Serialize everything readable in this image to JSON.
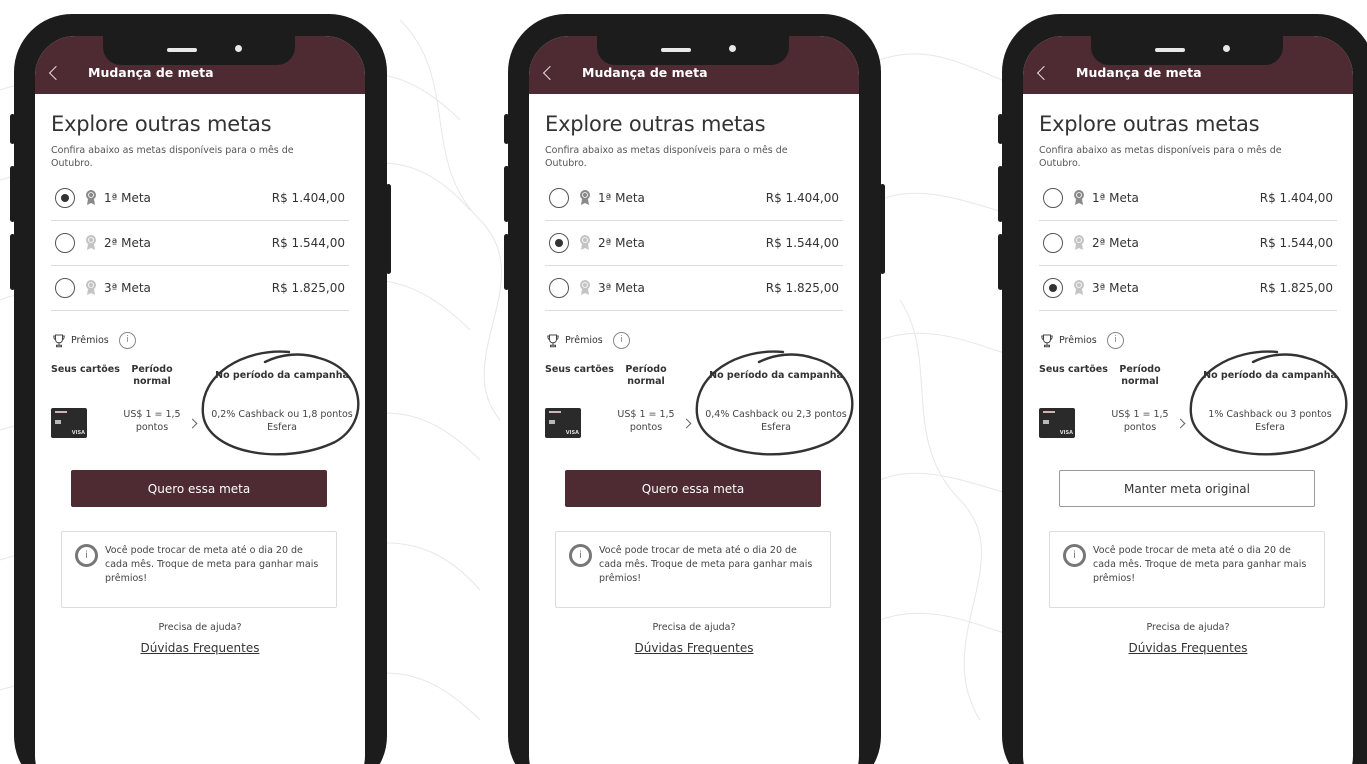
{
  "colors": {
    "brand": "#4e2a32",
    "frame": "#1c1c1c",
    "text": "#333333"
  },
  "icons": [
    "back-chevron-icon",
    "medal-icon",
    "trophy-icon",
    "info-icon",
    "chevron-right-icon",
    "credit-card-icon"
  ],
  "screens": [
    {
      "bar_title": "Mudança de meta",
      "heading": "Explore outras metas",
      "subtitle": "Confira abaixo as metas disponíveis para o mês de Outubro.",
      "goals": [
        {
          "label": "1ª Meta",
          "value": "R$ 1.404,00",
          "selected": true
        },
        {
          "label": "2ª Meta",
          "value": "R$ 1.544,00",
          "selected": false
        },
        {
          "label": "3ª Meta",
          "value": "R$ 1.825,00",
          "selected": false
        }
      ],
      "prizes_label": "Prêmios",
      "col_cards": "Seus cartões",
      "col_normal": "Período normal",
      "col_campaign": "No período da campanha",
      "normal_value": "US$ 1 = 1,5 pontos",
      "campaign_value": "0,2% Cashback ou 1,8 pontos Esfera",
      "button_label": "Quero essa meta",
      "button_style": "primary",
      "info_text": "Você pode trocar de meta até o dia 20 de cada mês. Troque de meta para ganhar mais prêmios!",
      "help_text": "Precisa de ajuda?",
      "faq_link": "Dúvidas Frequentes",
      "card_brand": "VISA"
    },
    {
      "bar_title": "Mudança de meta",
      "heading": "Explore outras metas",
      "subtitle": "Confira abaixo as metas disponíveis para o mês de Outubro.",
      "goals": [
        {
          "label": "1ª Meta",
          "value": "R$ 1.404,00",
          "selected": false
        },
        {
          "label": "2ª Meta",
          "value": "R$ 1.544,00",
          "selected": true
        },
        {
          "label": "3ª Meta",
          "value": "R$ 1.825,00",
          "selected": false
        }
      ],
      "prizes_label": "Prêmios",
      "col_cards": "Seus cartões",
      "col_normal": "Período normal",
      "col_campaign": "No período da campanha",
      "normal_value": "US$ 1 = 1,5 pontos",
      "campaign_value": "0,4% Cashback ou 2,3 pontos Esfera",
      "button_label": "Quero essa meta",
      "button_style": "primary",
      "info_text": "Você pode trocar de meta até o dia 20 de cada mês. Troque de meta para ganhar mais prêmios!",
      "help_text": "Precisa de ajuda?",
      "faq_link": "Dúvidas Frequentes",
      "card_brand": "VISA"
    },
    {
      "bar_title": "Mudança de meta",
      "heading": "Explore outras metas",
      "subtitle": "Confira abaixo as metas disponíveis para o mês de Outubro.",
      "goals": [
        {
          "label": "1ª Meta",
          "value": "R$ 1.404,00",
          "selected": false
        },
        {
          "label": "2ª Meta",
          "value": "R$ 1.544,00",
          "selected": false
        },
        {
          "label": "3ª Meta",
          "value": "R$ 1.825,00",
          "selected": true
        }
      ],
      "prizes_label": "Prêmios",
      "col_cards": "Seus cartões",
      "col_normal": "Período normal",
      "col_campaign": "No período da campanha",
      "normal_value": "US$ 1 = 1,5 pontos",
      "campaign_value": "1% Cashback ou 3 pontos Esfera",
      "button_label": "Manter meta original",
      "button_style": "outline",
      "info_text": "Você pode trocar de meta até o dia 20 de cada mês. Troque de meta para ganhar mais prêmios!",
      "help_text": "Precisa de ajuda?",
      "faq_link": "Dúvidas Frequentes",
      "card_brand": "VISA"
    }
  ]
}
